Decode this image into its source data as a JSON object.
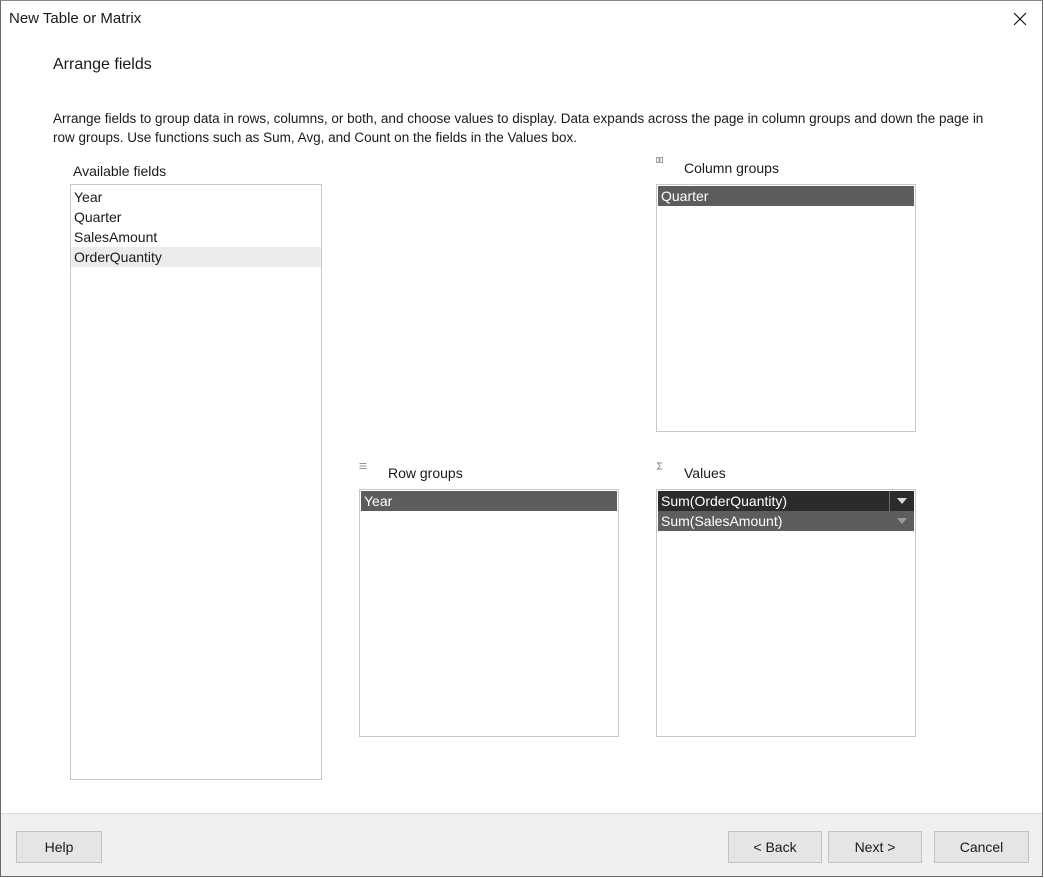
{
  "window": {
    "title": "New Table or Matrix"
  },
  "page": {
    "heading": "Arrange fields",
    "description": "Arrange fields to group data in rows, columns, or both, and choose values to display. Data expands across the page in column groups and down the page in row groups.  Use functions such as Sum, Avg, and Count on the fields in the Values box."
  },
  "available_fields": {
    "label": "Available fields",
    "items": [
      "Year",
      "Quarter",
      "SalesAmount",
      "OrderQuantity"
    ]
  },
  "column_groups": {
    "label": "Column groups",
    "items": [
      "Quarter"
    ]
  },
  "row_groups": {
    "label": "Row groups",
    "items": [
      "Year"
    ]
  },
  "values": {
    "label": "Values",
    "items": [
      "Sum(OrderQuantity)",
      "Sum(SalesAmount)"
    ]
  },
  "footer": {
    "help": "Help",
    "back": "< Back",
    "next": "Next >",
    "cancel": "Cancel"
  },
  "icons": {
    "close": "close-icon",
    "column_groups": "column-groups-icon",
    "row_groups": "row-groups-icon",
    "values": "sigma-icon",
    "dropdown": "dropdown-arrow-icon"
  },
  "colors": {
    "selected_dark": "#2b2b2b",
    "selected_mid": "#5d5d5d",
    "footer_bg": "#f0f0f0",
    "button_bg": "#e5e5e5"
  }
}
